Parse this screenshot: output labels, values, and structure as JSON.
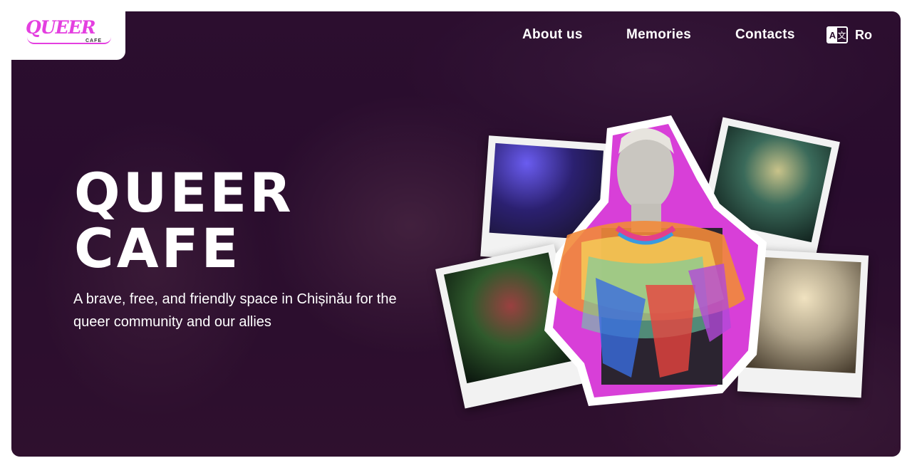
{
  "logo": {
    "word": "QUEER",
    "sub": "CAFE"
  },
  "nav": [
    {
      "label": "About us"
    },
    {
      "label": "Memories"
    },
    {
      "label": "Contacts"
    }
  ],
  "language": {
    "icon_left": "A",
    "icon_right": "文",
    "label": "Ro"
  },
  "hero": {
    "title_line1": "QUEER",
    "title_line2": "CAFE",
    "tagline": "A brave, free, and friendly space in Chișinău for the queer community and our allies"
  },
  "colors": {
    "accent": "#e43fe0",
    "background": "#2a0f2e",
    "text": "#ffffff"
  },
  "icons": {
    "language": "translate-icon"
  }
}
